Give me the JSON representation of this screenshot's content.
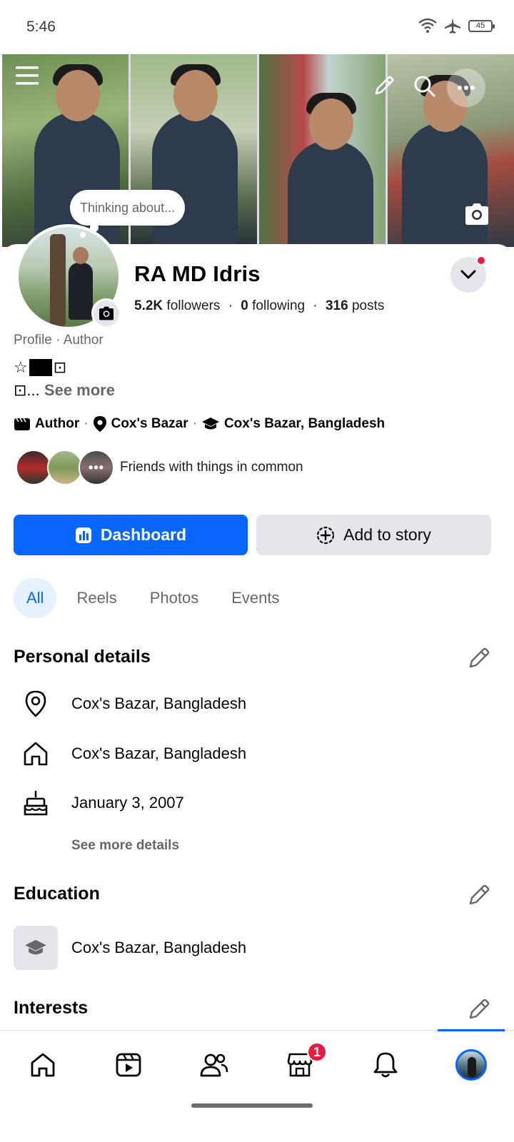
{
  "status_bar": {
    "time": "5:46",
    "battery": "45"
  },
  "cover": {
    "thought_bubble": "Thinking about..."
  },
  "profile": {
    "name": "RA MD Idris",
    "followers_count": "5.2K",
    "followers_label": "followers",
    "following_count": "0",
    "following_label": "following",
    "posts_count": "316",
    "posts_label": "posts",
    "subtitle": "Profile · Author",
    "bio_line1_prefix": "☆",
    "bio_line1_suffix": "⊡",
    "bio_line2_prefix": "⊡...",
    "see_more": "See more"
  },
  "intro": {
    "work": "Author",
    "location": "Cox's Bazar",
    "education": "Cox's Bazar, Bangladesh"
  },
  "friends": {
    "label": "Friends with things in common",
    "more": "•••"
  },
  "actions": {
    "dashboard": "Dashboard",
    "add_story": "Add to story"
  },
  "tabs": [
    {
      "label": "All",
      "active": true
    },
    {
      "label": "Reels"
    },
    {
      "label": "Photos"
    },
    {
      "label": "Events"
    }
  ],
  "personal_details": {
    "title": "Personal details",
    "items": [
      {
        "icon": "location-pin-icon",
        "text": "Cox's Bazar, Bangladesh"
      },
      {
        "icon": "home-icon",
        "text": "Cox's Bazar, Bangladesh"
      },
      {
        "icon": "birthday-cake-icon",
        "text": "January 3, 2007"
      }
    ],
    "see_more": "See more details"
  },
  "education": {
    "title": "Education",
    "school": "Cox's Bazar, Bangladesh"
  },
  "interests": {
    "title": "Interests"
  },
  "bottom_nav": {
    "items": [
      "home-icon",
      "video-icon",
      "friends-icon",
      "marketplace-icon",
      "bell-icon",
      "profile-avatar"
    ],
    "marketplace_badge": "1"
  },
  "colors": {
    "accent": "#0866ff",
    "badge": "#e41e3f",
    "secondary_bg": "#e4e6eb"
  }
}
